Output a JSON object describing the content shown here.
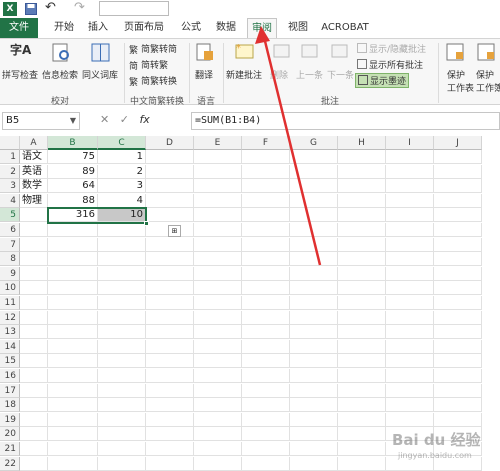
{
  "quick_access": {
    "excel_icon": "X",
    "undo_glyph": "↶",
    "redo_glyph": "↷"
  },
  "tabs": [
    "文件",
    "开始",
    "插入",
    "页面布局",
    "公式",
    "数据",
    "审阅",
    "视图",
    "ACROBAT"
  ],
  "active_tab": "审阅",
  "ribbon": {
    "spelling": "拼写检查",
    "research": "信息检索",
    "thesaurus": "同义词库",
    "proofing_group": "校对",
    "to_traditional": "简繁转简",
    "to_simplified": "简转繁",
    "convert": "简繁转换",
    "chinese_group": "中文简繁转换",
    "translate": "翻译",
    "language_group": "语言",
    "new_comment": "新建批注",
    "delete": "删除",
    "previous": "上一条",
    "next": "下一条",
    "show_hide_comment": "显示/隐藏批注",
    "show_all_comments": "显示所有批注",
    "show_ink": "显示墨迹",
    "comments_group": "批注",
    "protect_sheet_1": "保护",
    "protect_sheet_2": "工作表",
    "protect_workbook_1": "保护",
    "protect_workbook_2": "工作簿"
  },
  "formula_bar": {
    "name_box": "B5",
    "formula": "=SUM(B1:B4)",
    "fx": "fx"
  },
  "columns": [
    "A",
    "B",
    "C",
    "D",
    "E",
    "F",
    "G",
    "H",
    "I",
    "J"
  ],
  "rows": [
    "1",
    "2",
    "3",
    "4",
    "5",
    "6",
    "7",
    "8",
    "9",
    "10",
    "11",
    "12",
    "13",
    "14",
    "15",
    "16",
    "17",
    "18",
    "19",
    "20",
    "21",
    "22"
  ],
  "cells": [
    [
      "语文",
      "75",
      "1"
    ],
    [
      "英语",
      "89",
      "2"
    ],
    [
      "数学",
      "64",
      "3"
    ],
    [
      "物理",
      "88",
      "4"
    ],
    [
      "",
      "316",
      "10"
    ]
  ],
  "watermark": {
    "main": "Bai du 经验",
    "sub": "jingyan.baidu.com"
  }
}
